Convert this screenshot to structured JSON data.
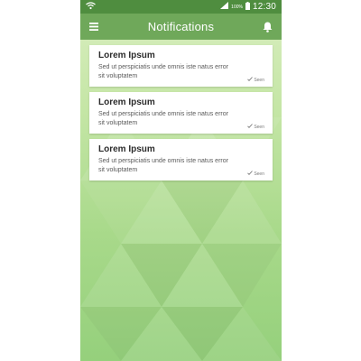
{
  "status_bar": {
    "battery": "100%",
    "time": "12:30",
    "icons": [
      "wifi-icon",
      "signal-icon",
      "battery-icon"
    ]
  },
  "app_bar": {
    "title": "Notifications",
    "menu_icon": "menu-icon",
    "bell_icon": "bell-icon"
  },
  "notifications": [
    {
      "title": "Lorem Ipsum",
      "body": "Sed ut perspiciatis unde omnis iste natus error sit voluptatem",
      "status": "Seen"
    },
    {
      "title": "Lorem Ipsum",
      "body": "Sed ut perspiciatis unde omnis iste natus error sit voluptatem",
      "status": "Seen"
    },
    {
      "title": "Lorem Ipsum",
      "body": "Sed ut perspiciatis unde omnis iste natus error sit voluptatem",
      "status": "Seen"
    }
  ],
  "colors": {
    "status_bar": "#4f8d3f",
    "app_bar": "#6fa85a",
    "background_top": "#d9eec0",
    "background_bottom": "#95d07c"
  }
}
